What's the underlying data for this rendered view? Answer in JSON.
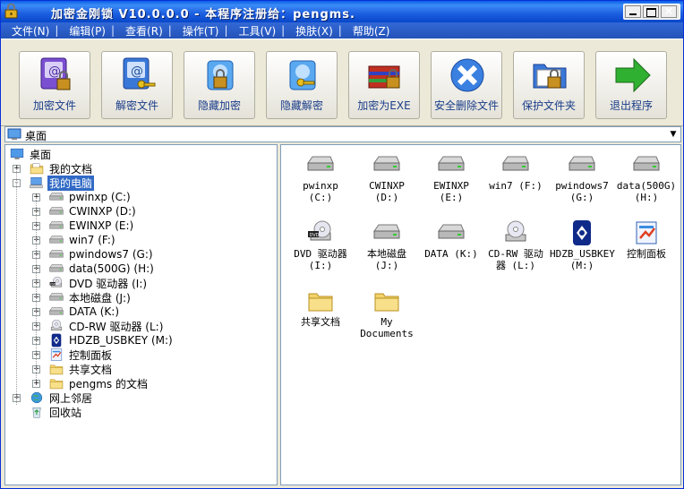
{
  "window": {
    "title": "加密金刚锁 V10.0.0.0 - 本程序注册给：pengms."
  },
  "menu": [
    "文件(N)",
    "编辑(P)",
    "查看(R)",
    "操作(T)",
    "工具(V)",
    "换肤(X)",
    "帮助(Z)"
  ],
  "toolbar": [
    {
      "label": "加密文件",
      "icon": "encrypt-book-icon"
    },
    {
      "label": "解密文件",
      "icon": "decrypt-book-icon"
    },
    {
      "label": "隐藏加密",
      "icon": "hide-encrypt-drive-icon"
    },
    {
      "label": "隐藏解密",
      "icon": "hide-decrypt-drive-icon"
    },
    {
      "label": "加密为EXE",
      "icon": "encrypt-exe-icon"
    },
    {
      "label": "安全删除文件",
      "icon": "secure-delete-icon"
    },
    {
      "label": "保护文件夹",
      "icon": "protect-folder-icon"
    },
    {
      "label": "退出程序",
      "icon": "exit-arrow-icon"
    }
  ],
  "address": {
    "value": "桌面"
  },
  "tree": [
    {
      "label": "桌面",
      "level": 0,
      "icon": "desktop",
      "expander": ""
    },
    {
      "label": "我的文档",
      "level": 1,
      "icon": "documents",
      "expander": "+"
    },
    {
      "label": "我的电脑",
      "level": 1,
      "icon": "computer",
      "expander": "-",
      "selected": true
    },
    {
      "label": "pwinxp (C:)",
      "level": 2,
      "icon": "drive",
      "expander": "+"
    },
    {
      "label": "CWINXP (D:)",
      "level": 2,
      "icon": "drive",
      "expander": "+"
    },
    {
      "label": "EWINXP (E:)",
      "level": 2,
      "icon": "drive",
      "expander": "+"
    },
    {
      "label": "win7 (F:)",
      "level": 2,
      "icon": "drive",
      "expander": "+"
    },
    {
      "label": "pwindows7 (G:)",
      "level": 2,
      "icon": "drive",
      "expander": "+"
    },
    {
      "label": "data(500G) (H:)",
      "level": 2,
      "icon": "drive",
      "expander": "+"
    },
    {
      "label": "DVD 驱动器 (I:)",
      "level": 2,
      "icon": "dvd",
      "expander": "+"
    },
    {
      "label": "本地磁盘 (J:)",
      "level": 2,
      "icon": "drive",
      "expander": "+"
    },
    {
      "label": "DATA (K:)",
      "level": 2,
      "icon": "drive",
      "expander": "+"
    },
    {
      "label": "CD-RW 驱动器 (L:)",
      "level": 2,
      "icon": "cdrom",
      "expander": "+"
    },
    {
      "label": "HDZB_USBKEY (M:)",
      "level": 2,
      "icon": "usbkey",
      "expander": "+"
    },
    {
      "label": "控制面板",
      "level": 2,
      "icon": "control",
      "expander": "+"
    },
    {
      "label": "共享文档",
      "level": 2,
      "icon": "folder",
      "expander": "+"
    },
    {
      "label": "pengms 的文档",
      "level": 2,
      "icon": "folder",
      "expander": "+"
    },
    {
      "label": "网上邻居",
      "level": 1,
      "icon": "network",
      "expander": "+"
    },
    {
      "label": "回收站",
      "level": 1,
      "icon": "recycle",
      "expander": ""
    }
  ],
  "files": [
    {
      "label": "pwinxp (C:)",
      "icon": "drive"
    },
    {
      "label": "CWINXP (D:)",
      "icon": "drive"
    },
    {
      "label": "EWINXP (E:)",
      "icon": "drive"
    },
    {
      "label": "win7 (F:)",
      "icon": "drive"
    },
    {
      "label": "pwindows7\n(G:)",
      "icon": "drive"
    },
    {
      "label": "data(500G)\n(H:)",
      "icon": "drive"
    },
    {
      "label": "DVD 驱动器\n(I:)",
      "icon": "dvd"
    },
    {
      "label": "本地磁盘\n(J:)",
      "icon": "drive"
    },
    {
      "label": "DATA (K:)",
      "icon": "drive"
    },
    {
      "label": "CD-RW 驱动\n器 (L:)",
      "icon": "cdrom"
    },
    {
      "label": "HDZB_USBKEY\n(M:)",
      "icon": "usbkey"
    },
    {
      "label": "控制面板",
      "icon": "control"
    },
    {
      "label": "共享文档",
      "icon": "folder"
    },
    {
      "label": "My\nDocuments",
      "icon": "folder"
    }
  ]
}
